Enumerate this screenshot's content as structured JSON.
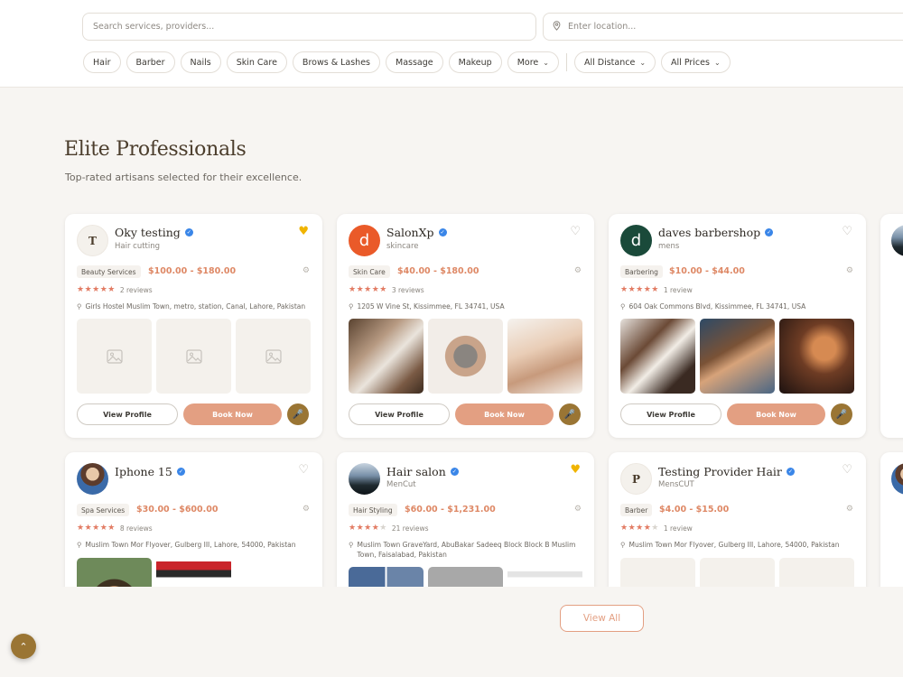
{
  "search": {
    "service_placeholder": "Search services, providers...",
    "location_placeholder": "Enter location..."
  },
  "filters": {
    "categories": [
      "Hair",
      "Barber",
      "Nails",
      "Skin Care",
      "Brows & Lashes",
      "Massage",
      "Makeup"
    ],
    "more_label": "More",
    "distance_label": "All Distance",
    "prices_label": "All Prices"
  },
  "section": {
    "title": "Elite Professionals",
    "subtitle": "Top-rated artisans selected for their excellence."
  },
  "cards": [
    {
      "initial": "T",
      "name": "Oky testing",
      "category": "Hair cutting",
      "favorite": true,
      "tag": "Beauty Services",
      "price": "$100.00 - $180.00",
      "rating": 5,
      "reviews": "2 reviews",
      "address": "Girls Hostel Muslim Town, metro, station, Canal, Lahore, Pakistan"
    },
    {
      "initial": "d",
      "name": "SalonXp",
      "category": "skincare",
      "favorite": false,
      "tag": "Skin Care",
      "price": "$40.00 - $180.00",
      "rating": 5,
      "reviews": "3 reviews",
      "address": "1205 W Vine St, Kissimmee, FL 34741, USA"
    },
    {
      "initial": "d",
      "name": "daves barbershop",
      "category": "mens",
      "favorite": false,
      "tag": "Barbering",
      "price": "$10.00 - $44.00",
      "rating": 5,
      "reviews": "1 review",
      "address": "604 Oak Commons Blvd, Kissimmee, FL 34741, USA"
    },
    {
      "initial": "",
      "name": "Iphone 15",
      "category": "",
      "favorite": false,
      "tag": "Spa Services",
      "price": "$30.00 - $600.00",
      "rating": 5,
      "reviews": "8 reviews",
      "address": "Muslim Town Mor Flyover, Gulberg III, Lahore, 54000, Pakistan"
    },
    {
      "initial": "",
      "name": "Hair salon",
      "category": "MenCut",
      "favorite": true,
      "tag": "Hair Styling",
      "price": "$60.00 - $1,231.00",
      "rating": 4,
      "reviews": "21 reviews",
      "address": "Muslim Town GraveYard, AbuBakar Sadeeq Block Block B Muslim Town, Faisalabad, Pakistan"
    },
    {
      "initial": "P",
      "name": "Testing Provider Hair",
      "category": "MensCUT",
      "favorite": false,
      "tag": "Barber",
      "price": "$4.00 - $15.00",
      "rating": 4,
      "reviews": "1 review",
      "address": "Muslim Town Mor Flyover, Gulberg III, Lahore, 54000, Pakistan"
    }
  ],
  "buttons": {
    "view_profile": "View Profile",
    "book_now": "Book Now",
    "view_all": "View All"
  },
  "colors": {
    "accent": "#e39f82",
    "price": "#de8865",
    "gold": "#9a7534",
    "favorite": "#f0b400",
    "verified": "#3a86e8"
  }
}
